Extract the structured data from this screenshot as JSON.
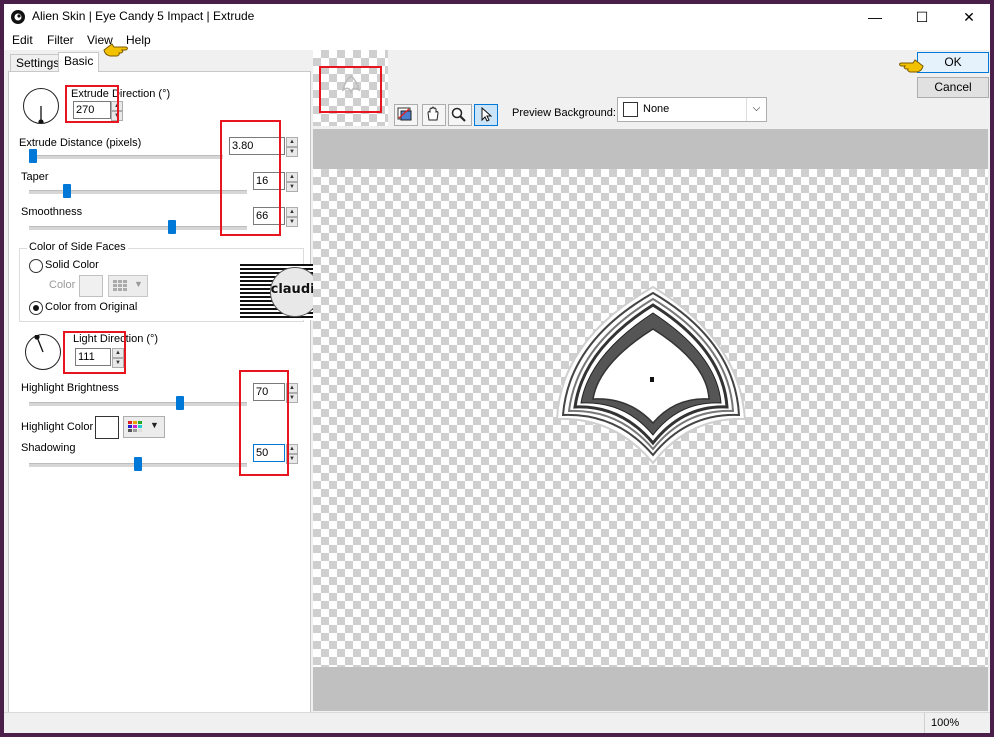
{
  "window": {
    "title": "Alien Skin | Eye Candy 5 Impact | Extrude",
    "minimize_glyph": "—",
    "maximize_glyph": "☐",
    "close_glyph": "✕"
  },
  "menu": {
    "items": [
      "Edit",
      "Filter",
      "View",
      "Help"
    ]
  },
  "tabs": {
    "settings": "Settings",
    "basic": "Basic"
  },
  "basic": {
    "extrude_direction_label": "Extrude Direction (°)",
    "extrude_direction_value": "270",
    "extrude_distance_label": "Extrude Distance (pixels)",
    "extrude_distance_value": "3.80",
    "extrude_distance_fraction": 0.0,
    "taper_label": "Taper",
    "taper_value": "16",
    "taper_fraction": 0.16,
    "smoothness_label": "Smoothness",
    "smoothness_value": "66",
    "smoothness_fraction": 0.66,
    "side_faces_group_label": "Color of Side Faces",
    "solid_color_label": "Solid Color",
    "color_label": "Color",
    "color_from_original_label": "Color from Original",
    "light_direction_label": "Light Direction (°)",
    "light_direction_value": "111",
    "highlight_brightness_label": "Highlight Brightness",
    "highlight_brightness_value": "70",
    "highlight_brightness_fraction": 0.7,
    "highlight_color_label": "Highlight Color",
    "shadowing_label": "Shadowing",
    "shadowing_value": "50",
    "shadowing_fraction": 0.5
  },
  "watermark": {
    "text": "claudia"
  },
  "toolbar": {
    "preview_background_label": "Preview Background:",
    "preview_background_value": "None"
  },
  "buttons": {
    "ok": "OK",
    "cancel": "Cancel"
  },
  "status": {
    "zoom": "100%"
  },
  "colors": {
    "accent": "#0078d7",
    "annotation_red": "#e8141e",
    "pointer_yellow": "#f2c200",
    "frame": "#4a1f4a"
  },
  "icons": [
    "app-logo-icon",
    "preview-background-icon",
    "hand-tool-icon",
    "zoom-tool-icon",
    "pointer-tool-icon",
    "color-grid-icon",
    "chevron-down-icon"
  ]
}
